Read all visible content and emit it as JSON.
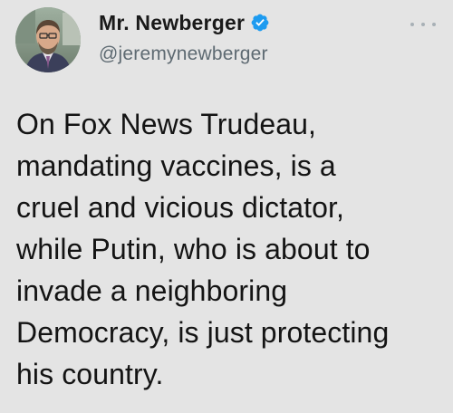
{
  "author": {
    "display_name": "Mr. Newberger",
    "handle": "@jeremynewberger",
    "verified": true,
    "avatar_icon": "profile-photo"
  },
  "tweet": {
    "text": "On Fox News Trudeau,\nmandating vaccines, is a\ncruel and vicious dictator,\nwhile Putin, who is about to\ninvade a neighboring\nDemocracy, is just protecting\nhis country."
  },
  "icons": {
    "more": "more-options-icon",
    "verified": "verified-badge-icon"
  },
  "colors": {
    "background": "#e4e4e4",
    "verified": "#1d9bf0",
    "handle": "#5e6a72"
  }
}
